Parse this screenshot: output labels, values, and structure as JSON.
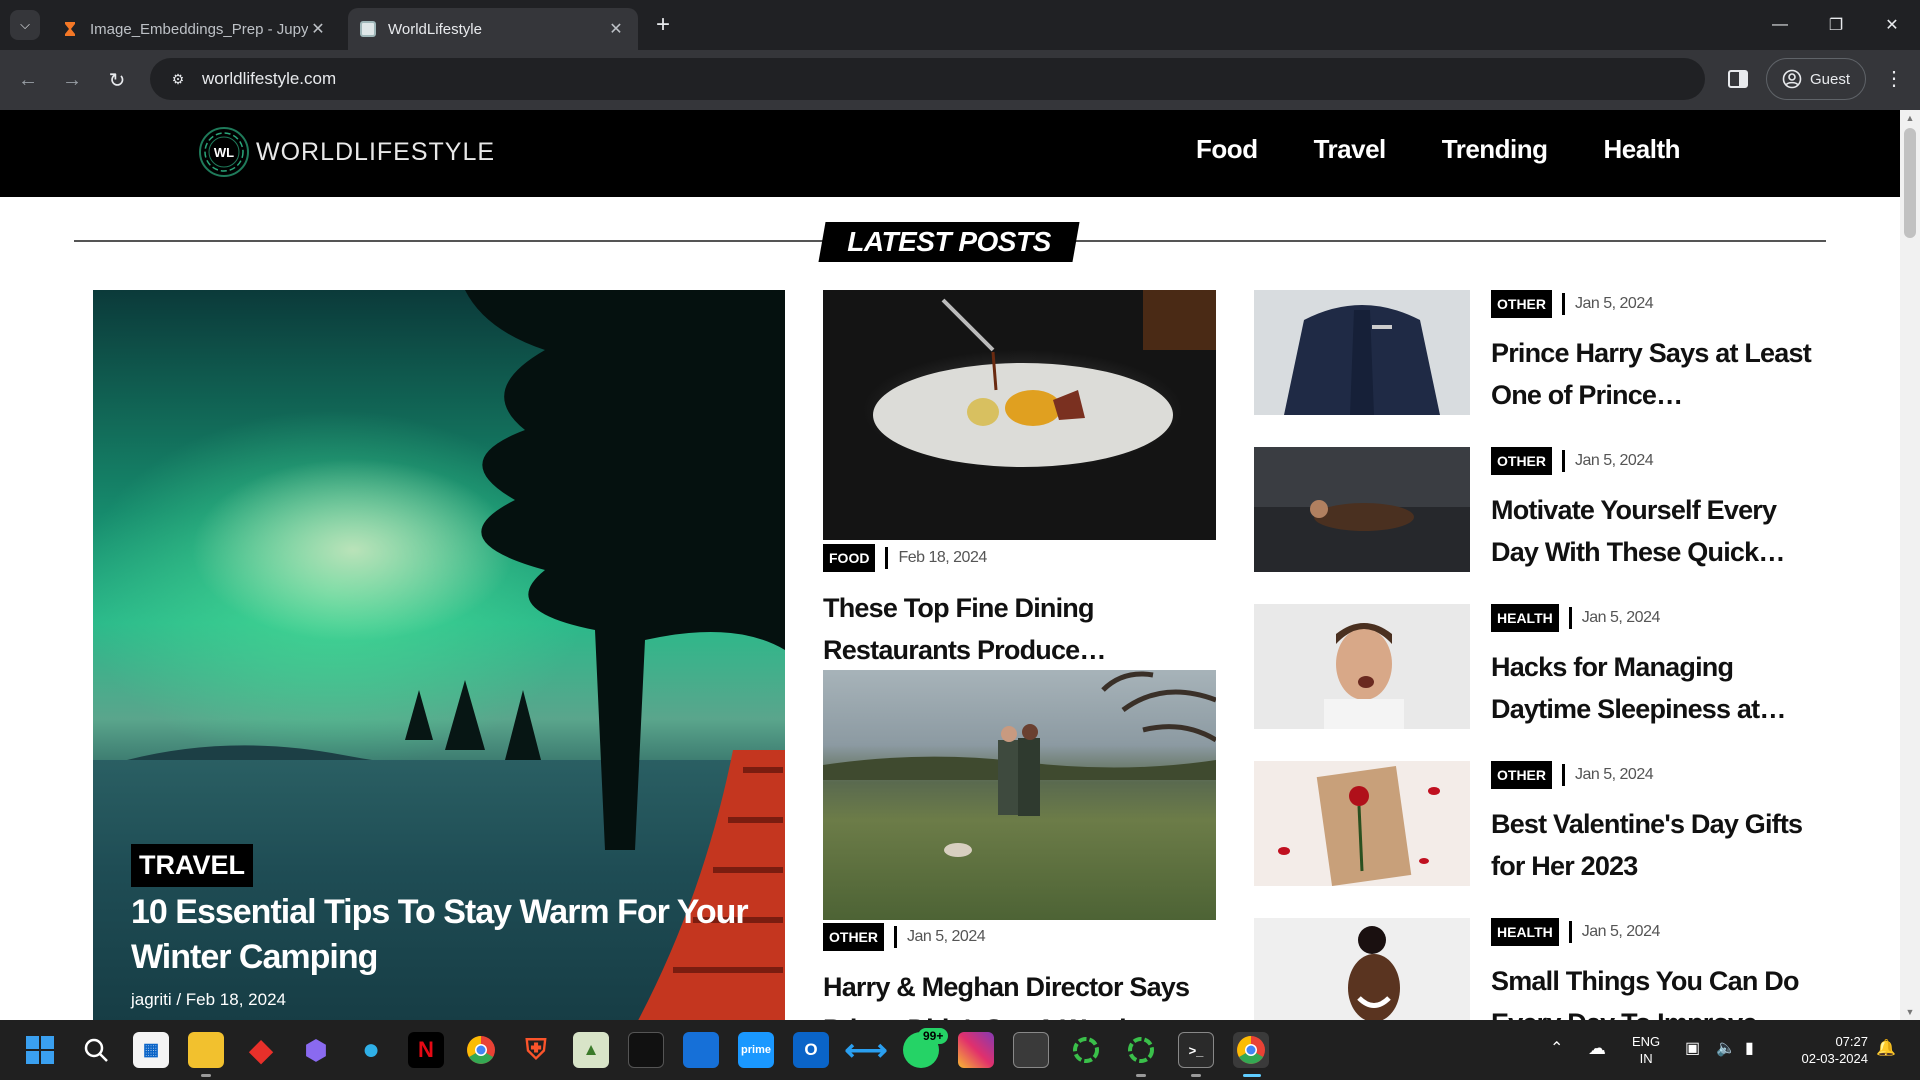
{
  "browser": {
    "tabs": [
      {
        "title": "Image_Embeddings_Prep - Jupyter",
        "active": false
      },
      {
        "title": "WorldLifestyle",
        "active": true
      }
    ],
    "url": "worldlifestyle.com",
    "profile_label": "Guest"
  },
  "site": {
    "logo_initials": "WL",
    "logo_text": "WORLDLIFESTYLE",
    "nav": [
      "Food",
      "Travel",
      "Trending",
      "Health"
    ],
    "section_title": "LATEST POSTS"
  },
  "hero": {
    "category": "TRAVEL",
    "title": "10 Essential Tips To Stay Warm For Your Winter Camping",
    "meta": "jagriti / Feb 18, 2024"
  },
  "middle_posts": [
    {
      "category": "FOOD",
      "date": "Feb 18, 2024",
      "title": "These Top Fine Dining Restaurants Produce…"
    },
    {
      "category": "OTHER",
      "date": "Jan 5, 2024",
      "title": "Harry & Meghan Director Says Prince Didn't Say A Word"
    }
  ],
  "side_posts": [
    {
      "category": "OTHER",
      "date": "Jan 5, 2024",
      "title": "Prince Harry Says at Least One of Prince…"
    },
    {
      "category": "OTHER",
      "date": "Jan 5, 2024",
      "title": "Motivate Yourself Every Day With These Quick…"
    },
    {
      "category": "HEALTH",
      "date": "Jan 5, 2024",
      "title": "Hacks for Managing Daytime Sleepiness at…"
    },
    {
      "category": "OTHER",
      "date": "Jan 5, 2024",
      "title": "Best Valentine's Day Gifts for Her 2023"
    },
    {
      "category": "HEALTH",
      "date": "Jan 5, 2024",
      "title": "Small Things You Can Do Every Day To Improve"
    }
  ],
  "taskbar": {
    "whatsapp_badge": "99+",
    "language": "ENG",
    "region": "IN",
    "time": "07:27",
    "date": "02-03-2024"
  },
  "colors": {
    "chrome_dark": "#202124",
    "chrome_toolbar": "#35363a",
    "site_header": "#000000",
    "taskbar": "#202020"
  }
}
